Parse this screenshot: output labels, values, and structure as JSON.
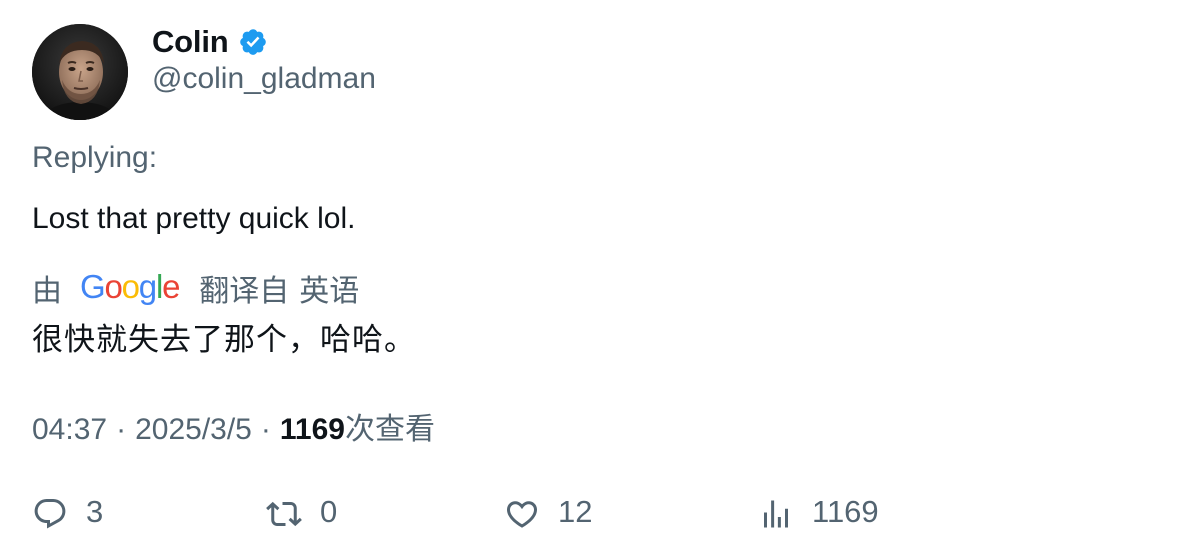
{
  "author": {
    "display_name": "Colin",
    "handle": "@colin_gladman",
    "verified_icon": "verified-badge-icon",
    "verified_color": "#1d9bf0"
  },
  "replying_label": "Replying:",
  "tweet_text": "Lost that pretty quick lol.",
  "translation": {
    "by_label": "由",
    "provider": "Google",
    "from_label": "翻译自",
    "language": "英语",
    "translated_text": "很快就失去了那个，哈哈。"
  },
  "meta": {
    "time": "04:37",
    "separator": "·",
    "date": "2025/3/5",
    "views_count": "1169",
    "views_label": "次查看"
  },
  "actions": {
    "reply_count": "3",
    "retweet_count": "0",
    "like_count": "12",
    "views_count": "1169"
  },
  "colors": {
    "text_primary": "#0f1419",
    "text_secondary": "#536471"
  }
}
